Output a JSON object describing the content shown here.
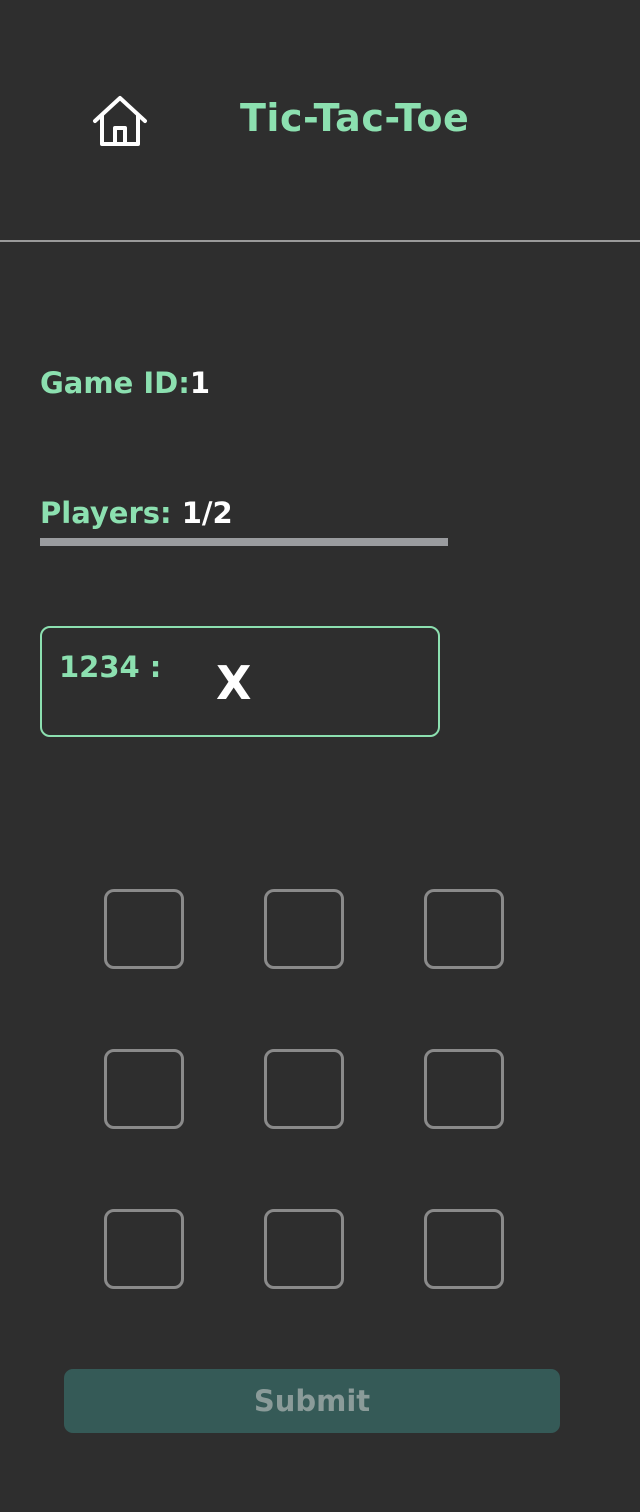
{
  "header": {
    "home_icon": "home-icon",
    "title": "Tic-Tac-Toe"
  },
  "game": {
    "id_label": "Game ID:",
    "id_value": "1",
    "players_label": "Players:",
    "players_value": "1/2",
    "players_fill_fraction": 1.0
  },
  "player_card": {
    "player_id": "1234 :",
    "symbol": "X"
  },
  "board": {
    "cells": [
      "",
      "",
      "",
      "",
      "",
      "",
      "",
      "",
      ""
    ]
  },
  "submit": {
    "label": "Submit"
  },
  "colors": {
    "background": "#2e2e2e",
    "accent": "#8ce0b0",
    "cell_border": "#8a8a8a",
    "submit_bg": "#355a57",
    "submit_text": "#8a9b99"
  }
}
